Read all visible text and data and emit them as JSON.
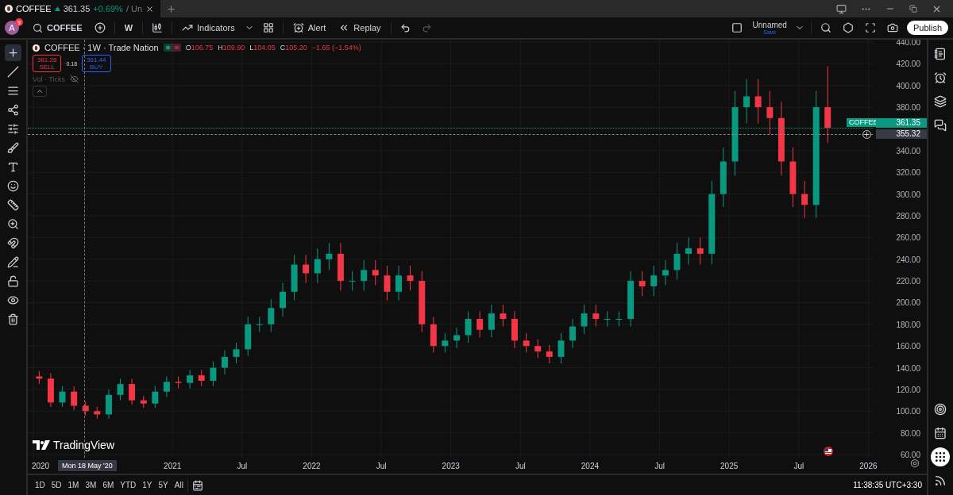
{
  "tab": {
    "symbol": "COFFEE",
    "price": "361.35",
    "change": "+0.69%",
    "rest": "/ Un"
  },
  "toolbar": {
    "avatar": "A",
    "badge": "9",
    "symbol": "COFFEE",
    "interval": "W",
    "indicators": "Indicators",
    "alert": "Alert",
    "replay": "Replay",
    "layout_name": "Unnamed",
    "layout_status": "Save",
    "publish": "Publish"
  },
  "tools": [
    {
      "kind": "cross",
      "selected": true
    },
    {
      "kind": "line",
      "selected": false
    },
    {
      "kind": "fib",
      "selected": false
    },
    {
      "kind": "pattern",
      "selected": false
    },
    {
      "kind": "forecast",
      "selected": false
    },
    {
      "kind": "brush",
      "selected": false
    },
    {
      "kind": "text",
      "selected": false
    },
    {
      "kind": "emoji",
      "selected": false
    },
    {
      "kind": "ruler",
      "selected": false
    },
    {
      "kind": "zoom",
      "selected": false
    },
    {
      "kind": "magnet",
      "selected": false
    },
    {
      "kind": "pencil",
      "selected": false
    },
    {
      "kind": "lock",
      "selected": false
    },
    {
      "kind": "eye",
      "selected": false
    },
    {
      "kind": "trash",
      "selected": false
    }
  ],
  "legend": {
    "title": "COFFEE · 1W · Trade Nation",
    "ohlc": [
      {
        "label": "O",
        "value": "106.75"
      },
      {
        "label": "H",
        "value": "109.90"
      },
      {
        "label": "L",
        "value": "104.05"
      },
      {
        "label": "C",
        "value": "105.20"
      }
    ],
    "change": "−1.65 (−1.54%)",
    "sell": {
      "price": "361.26",
      "label": "SELL"
    },
    "spread": "0.18",
    "buy": {
      "price": "361.44",
      "label": "BUY"
    },
    "volume": "Vol · Ticks"
  },
  "chart": {
    "chart_data": {
      "type": "candlestick",
      "grid": true,
      "xlim": [
        2019.96,
        2026.42
      ],
      "ylim": [
        23.5,
        442.2
      ],
      "xticks": [
        {
          "value": 2020,
          "label": "2020"
        },
        {
          "value": 2021,
          "label": "2021"
        },
        {
          "value": 2021.5,
          "label": "Jul"
        },
        {
          "value": 2022,
          "label": "2022"
        },
        {
          "value": 2022.5,
          "label": "Jul"
        },
        {
          "value": 2023,
          "label": "2023"
        },
        {
          "value": 2023.5,
          "label": "Jul"
        },
        {
          "value": 2024,
          "label": "2024"
        },
        {
          "value": 2024.5,
          "label": "Jul"
        },
        {
          "value": 2025,
          "label": "2025"
        },
        {
          "value": 2025.5,
          "label": "Jul"
        },
        {
          "value": 2026,
          "label": "2026"
        }
      ],
      "yticks": [
        {
          "value": 440,
          "label": "440.00"
        },
        {
          "value": 420,
          "label": "420.00"
        },
        {
          "value": 400,
          "label": "400.00"
        },
        {
          "value": 380,
          "label": "380.00"
        },
        {
          "value": 340,
          "label": "340.00"
        },
        {
          "value": 320,
          "label": "320.00"
        },
        {
          "value": 300,
          "label": "300.00"
        },
        {
          "value": 280,
          "label": "280.00"
        },
        {
          "value": 260,
          "label": "260.00"
        },
        {
          "value": 240,
          "label": "240.00"
        },
        {
          "value": 220,
          "label": "220.00"
        },
        {
          "value": 200,
          "label": "200.00"
        },
        {
          "value": 180,
          "label": "180.00"
        },
        {
          "value": 160,
          "label": "160.00"
        },
        {
          "value": 140,
          "label": "140.00"
        },
        {
          "value": 120,
          "label": "120.00"
        },
        {
          "value": 100,
          "label": "100.00"
        },
        {
          "value": 80,
          "label": "80.00"
        },
        {
          "value": 60,
          "label": "60.00"
        }
      ],
      "x": [
        2020.042,
        2020.125,
        2020.208,
        2020.292,
        2020.375,
        2020.458,
        2020.542,
        2020.625,
        2020.708,
        2020.792,
        2020.875,
        2020.958,
        2021.042,
        2021.125,
        2021.208,
        2021.292,
        2021.375,
        2021.458,
        2021.542,
        2021.625,
        2021.708,
        2021.792,
        2021.875,
        2021.958,
        2022.042,
        2022.125,
        2022.208,
        2022.292,
        2022.375,
        2022.458,
        2022.542,
        2022.625,
        2022.708,
        2022.792,
        2022.875,
        2022.958,
        2023.042,
        2023.125,
        2023.208,
        2023.292,
        2023.375,
        2023.458,
        2023.542,
        2023.625,
        2023.708,
        2023.792,
        2023.875,
        2023.958,
        2024.042,
        2024.125,
        2024.208,
        2024.292,
        2024.375,
        2024.458,
        2024.542,
        2024.625,
        2024.708,
        2024.792,
        2024.875,
        2024.958,
        2025.042,
        2025.125,
        2025.208,
        2025.292,
        2025.375,
        2025.458,
        2025.542,
        2025.625,
        2025.708
      ],
      "ohlc": [
        [
          132,
          137,
          125,
          130
        ],
        [
          130,
          135,
          104,
          108
        ],
        [
          108,
          123,
          104,
          118
        ],
        [
          118,
          123,
          101,
          105
        ],
        [
          105,
          109,
          96,
          100
        ],
        [
          100,
          104,
          93,
          97
        ],
        [
          97,
          120,
          93,
          115
        ],
        [
          115,
          130,
          110,
          125
        ],
        [
          125,
          130,
          106,
          110
        ],
        [
          110,
          114,
          103,
          107
        ],
        [
          107,
          123,
          103,
          118
        ],
        [
          118,
          132,
          113,
          127
        ],
        [
          127,
          132,
          121,
          126
        ],
        [
          126,
          138,
          121,
          133
        ],
        [
          133,
          138,
          123,
          128
        ],
        [
          128,
          146,
          123,
          140
        ],
        [
          140,
          156,
          134,
          150
        ],
        [
          150,
          163,
          144,
          157
        ],
        [
          157,
          187,
          151,
          180
        ],
        [
          180,
          187,
          173,
          180
        ],
        [
          180,
          203,
          173,
          195
        ],
        [
          195,
          218,
          187,
          210
        ],
        [
          210,
          244,
          202,
          235
        ],
        [
          235,
          244,
          218,
          227
        ],
        [
          227,
          250,
          218,
          240
        ],
        [
          240,
          255,
          230,
          245
        ],
        [
          245,
          255,
          211,
          220
        ],
        [
          220,
          229,
          211,
          220
        ],
        [
          220,
          239,
          211,
          230
        ],
        [
          230,
          239,
          216,
          225
        ],
        [
          225,
          234,
          202,
          210
        ],
        [
          210,
          234,
          202,
          225
        ],
        [
          225,
          234,
          211,
          220
        ],
        [
          220,
          229,
          173,
          180
        ],
        [
          180,
          187,
          154,
          160
        ],
        [
          160,
          172,
          154,
          165
        ],
        [
          165,
          177,
          158,
          170
        ],
        [
          170,
          192,
          163,
          185
        ],
        [
          185,
          192,
          168,
          175
        ],
        [
          175,
          198,
          168,
          190
        ],
        [
          190,
          198,
          178,
          185
        ],
        [
          185,
          192,
          158,
          165
        ],
        [
          165,
          172,
          154,
          160
        ],
        [
          160,
          166,
          149,
          155
        ],
        [
          155,
          161,
          144,
          150
        ],
        [
          150,
          172,
          144,
          165
        ],
        [
          165,
          185,
          158,
          178
        ],
        [
          178,
          198,
          171,
          190
        ],
        [
          190,
          198,
          178,
          185
        ],
        [
          185,
          192,
          178,
          185
        ],
        [
          185,
          192,
          178,
          185
        ],
        [
          185,
          229,
          178,
          220
        ],
        [
          220,
          229,
          206,
          215
        ],
        [
          215,
          234,
          206,
          225
        ],
        [
          225,
          239,
          216,
          230
        ],
        [
          230,
          255,
          221,
          245
        ],
        [
          245,
          260,
          235,
          250
        ],
        [
          250,
          260,
          235,
          245
        ],
        [
          245,
          312,
          235,
          300
        ],
        [
          300,
          343,
          288,
          330
        ],
        [
          330,
          395,
          317,
          380
        ],
        [
          380,
          406,
          365,
          390
        ],
        [
          390,
          406,
          365,
          380
        ],
        [
          380,
          395,
          355,
          370
        ],
        [
          370,
          385,
          317,
          330
        ],
        [
          330,
          343,
          288,
          300
        ],
        [
          300,
          312,
          278,
          290
        ],
        [
          290,
          395,
          278,
          380
        ],
        [
          380,
          418,
          347,
          361
        ]
      ]
    },
    "last_price": {
      "symbol": "COFFEE",
      "price": "361.35"
    },
    "crosshair": {
      "price": "355.32",
      "date": "Mon 18 May '20"
    }
  },
  "brand": "TradingView",
  "sidebar": [
    {
      "kind": "watchlist",
      "selected": false
    },
    {
      "kind": "alerts",
      "selected": false
    },
    {
      "kind": "layers",
      "selected": false
    },
    {
      "kind": "chat",
      "selected": false
    },
    {
      "kind": "target",
      "selected": false
    },
    {
      "kind": "calendar",
      "selected": false
    },
    {
      "kind": "apps",
      "selected": true
    },
    {
      "kind": "feed",
      "selected": false
    }
  ],
  "ranges": [
    "1D",
    "5D",
    "1M",
    "3M",
    "6M",
    "YTD",
    "1Y",
    "5Y",
    "All"
  ],
  "clock": "11:38:35 UTC+3:30"
}
